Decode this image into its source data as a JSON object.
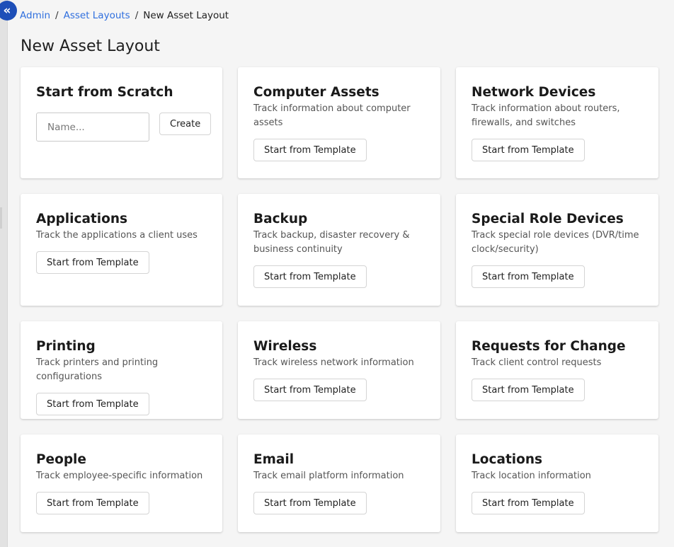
{
  "nav": {
    "collapse_glyph": "«",
    "collapse_icon": "double-chevron-left-icon"
  },
  "breadcrumb": {
    "items": [
      "Admin",
      "Asset Layouts"
    ],
    "separator": "/",
    "current": "New Asset Layout"
  },
  "page": {
    "title": "New Asset Layout"
  },
  "scratch": {
    "title": "Start from Scratch",
    "input_value": "",
    "input_placeholder": "Name...",
    "create_label": "Create"
  },
  "template_button_label": "Start from Template",
  "templates": [
    {
      "title": "Computer Assets",
      "description": "Track information about computer assets"
    },
    {
      "title": "Network Devices",
      "description": "Track information about routers, firewalls, and switches"
    },
    {
      "title": "Applications",
      "description": "Track the applications a client uses"
    },
    {
      "title": "Backup",
      "description": "Track backup, disaster recovery & business continuity"
    },
    {
      "title": "Special Role Devices",
      "description": "Track special role devices (DVR/time clock/security)"
    },
    {
      "title": "Printing",
      "description": "Track printers and printing configurations"
    },
    {
      "title": "Wireless",
      "description": "Track wireless network information"
    },
    {
      "title": "Requests for Change",
      "description": "Track client control requests"
    },
    {
      "title": "People",
      "description": "Track employee-specific information"
    },
    {
      "title": "Email",
      "description": "Track email platform information"
    },
    {
      "title": "Locations",
      "description": "Track location information"
    }
  ],
  "colors": {
    "accent": "#1e4fb8",
    "link": "#2f6fde",
    "background": "#f5f5f5",
    "card": "#ffffff"
  }
}
